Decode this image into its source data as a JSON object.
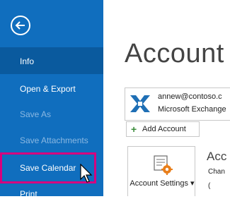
{
  "sidebar": {
    "items": [
      {
        "label": "Info"
      },
      {
        "label": "Open & Export"
      },
      {
        "label": "Save As"
      },
      {
        "label": "Save Attachments"
      },
      {
        "label": "Save Calendar"
      },
      {
        "label": "Print"
      }
    ]
  },
  "main": {
    "title": "Account",
    "account": {
      "email": "annew@contoso.c",
      "type": "Microsoft Exchange"
    },
    "add_account_label": "Add Account",
    "account_settings_label": "Account Settings ▾",
    "section_title": "Acc",
    "section_sub": "Chan",
    "section_sub2": "("
  },
  "colors": {
    "sidebar_bg": "#106ebe",
    "sidebar_selected_bg": "#0a5a9e",
    "highlight_border": "#d6007e",
    "disabled_text": "#8ab8e2"
  }
}
